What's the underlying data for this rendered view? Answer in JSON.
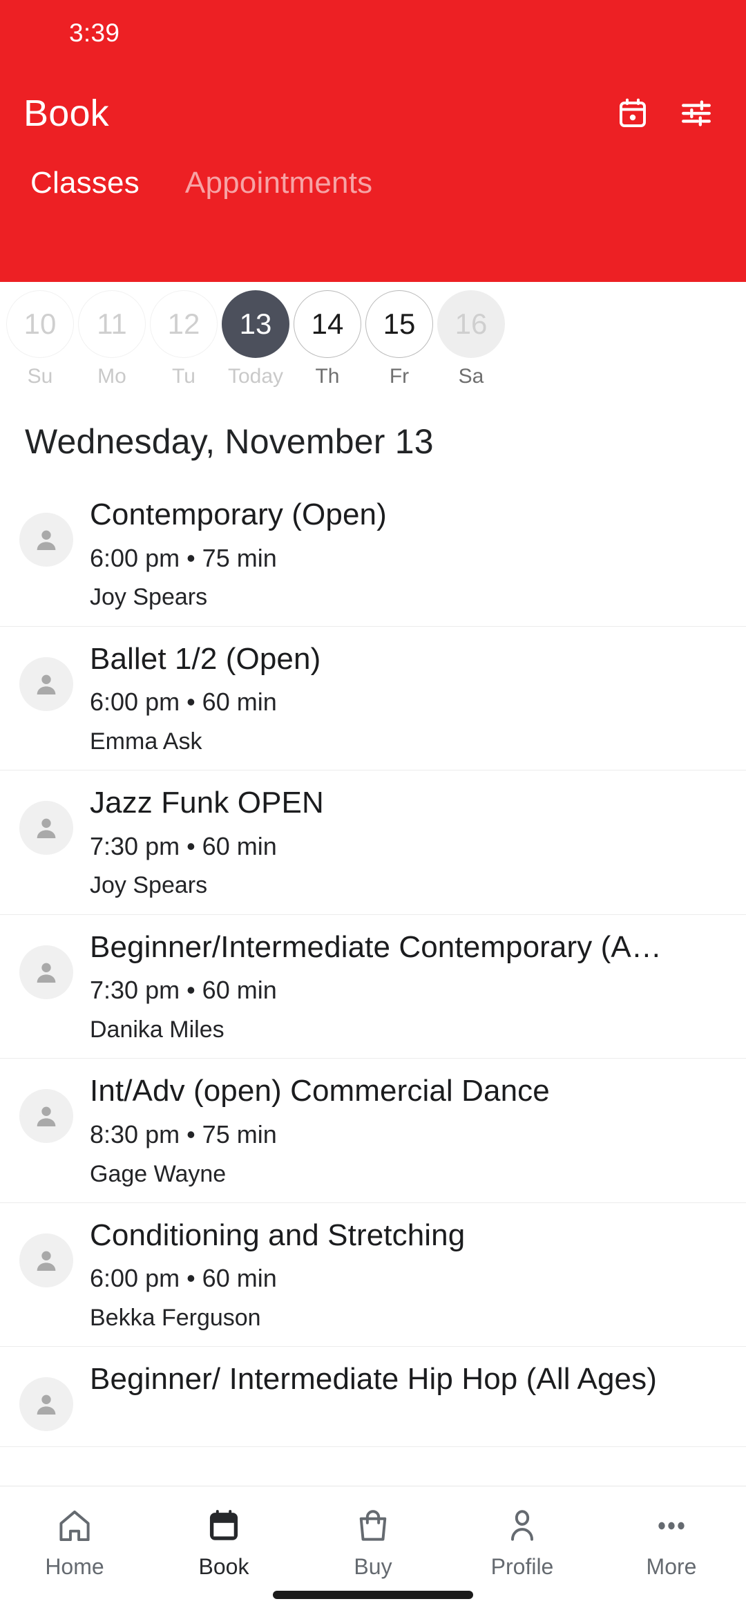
{
  "status_bar": {
    "time": "3:39"
  },
  "header": {
    "title": "Book",
    "accent_color": "#ED2024",
    "icons": {
      "calendar": "calendar-icon",
      "filter": "filter-sliders-icon"
    },
    "tabs": [
      {
        "label": "Classes",
        "active": true
      },
      {
        "label": "Appointments",
        "active": false
      }
    ]
  },
  "date_strip": {
    "days": [
      {
        "number": "10",
        "label": "Su",
        "state": "past"
      },
      {
        "number": "11",
        "label": "Mo",
        "state": "past"
      },
      {
        "number": "12",
        "label": "Tu",
        "state": "past"
      },
      {
        "number": "13",
        "label": "Today",
        "state": "today"
      },
      {
        "number": "14",
        "label": "Th",
        "state": "future"
      },
      {
        "number": "15",
        "label": "Fr",
        "state": "future"
      },
      {
        "number": "16",
        "label": "Sa",
        "state": "pressed"
      }
    ]
  },
  "selected_date_heading": "Wednesday, November 13",
  "classes": [
    {
      "name": "Contemporary (Open)",
      "meta": "6:00 pm • 75 min",
      "teacher": "Joy Spears",
      "avatar": "person-avatar-icon"
    },
    {
      "name": "Ballet 1/2 (Open)",
      "meta": "6:00 pm • 60 min",
      "teacher": "Emma Ask",
      "avatar": "person-avatar-icon"
    },
    {
      "name": "Jazz Funk OPEN",
      "meta": "7:30 pm • 60 min",
      "teacher": "Joy Spears",
      "avatar": "person-avatar-icon"
    },
    {
      "name": "Beginner/Intermediate Contemporary (A…",
      "meta": "7:30 pm • 60 min",
      "teacher": "Danika Miles",
      "avatar": "person-avatar-icon"
    },
    {
      "name": "Int/Adv (open) Commercial Dance",
      "meta": "8:30 pm • 75 min",
      "teacher": "Gage Wayne",
      "avatar": "person-avatar-icon"
    },
    {
      "name": "Conditioning and Stretching",
      "meta": "6:00 pm • 60 min",
      "teacher": "Bekka Ferguson",
      "avatar": "person-avatar-icon"
    },
    {
      "name": "Beginner/ Intermediate Hip Hop (All Ages)",
      "meta": "",
      "teacher": "",
      "avatar": "person-avatar-icon"
    }
  ],
  "bottom_nav": {
    "items": [
      {
        "label": "Home",
        "icon": "house-icon",
        "active": false
      },
      {
        "label": "Book",
        "icon": "calendar-filled-icon",
        "active": true
      },
      {
        "label": "Buy",
        "icon": "shopping-bag-icon",
        "active": false
      },
      {
        "label": "Profile",
        "icon": "person-icon",
        "active": false
      },
      {
        "label": "More",
        "icon": "ellipsis-icon",
        "active": false
      }
    ]
  }
}
